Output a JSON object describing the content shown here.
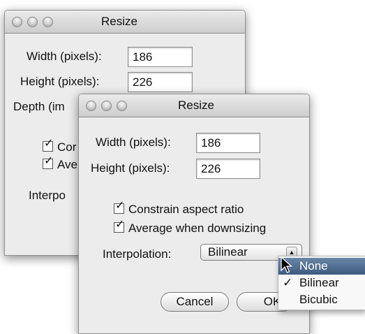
{
  "back_window": {
    "title": "Resize",
    "width_label": "Width (pixels):",
    "width_value": "186",
    "height_label": "Height (pixels):",
    "height_value": "226",
    "depth_label": "Depth (im",
    "constrain_label": "Cor",
    "average_label": "Ave",
    "interpolation_label": "Interpo"
  },
  "front_window": {
    "title": "Resize",
    "width_label": "Width (pixels):",
    "width_value": "186",
    "height_label": "Height (pixels):",
    "height_value": "226",
    "constrain_label": "Constrain aspect ratio",
    "constrain_checked": true,
    "average_label": "Average when downsizing",
    "average_checked": true,
    "interpolation_label": "Interpolation:",
    "interpolation_value": "Bilinear",
    "cancel_label": "Cancel",
    "ok_label": "OK"
  },
  "interpolation_menu": {
    "check_mark": "✓",
    "options": [
      {
        "label": "None",
        "highlighted": true,
        "checked": false
      },
      {
        "label": "Bilinear",
        "highlighted": false,
        "checked": true
      },
      {
        "label": "Bicubic",
        "highlighted": false,
        "checked": false
      }
    ]
  },
  "checkbox_glyph": "✓",
  "colors": {
    "menu_highlight": "#4b6a92",
    "window_bg": "#ececec"
  }
}
